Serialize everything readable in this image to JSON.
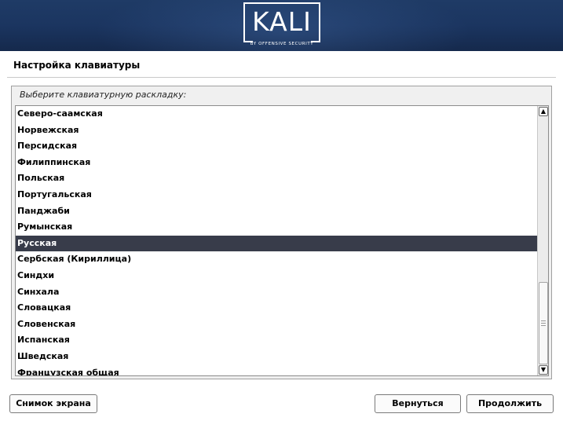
{
  "header": {
    "logo_text": "KALI",
    "logo_subtitle": "BY OFFENSIVE SECURITY"
  },
  "page": {
    "title": "Настройка клавиатуры"
  },
  "keyboard": {
    "prompt": "Выберите клавиатурную раскладку:",
    "selected_index": 8,
    "items": [
      "Северо-саамская",
      "Норвежская",
      "Персидская",
      "Филиппинская",
      "Польская",
      "Португальская",
      "Панджаби",
      "Румынская",
      "Русская",
      "Сербская (Кириллица)",
      "Синдхи",
      "Синхала",
      "Словацкая",
      "Словенская",
      "Испанская",
      "Шведская",
      "Французская общая"
    ]
  },
  "buttons": {
    "screenshot": "Снимок экрана",
    "back": "Вернуться",
    "continue": "Продолжить"
  },
  "colors": {
    "banner": "#1b3560",
    "selection": "#383c4a"
  },
  "icons": {
    "scroll_up": "chevron-up-icon",
    "scroll_down": "chevron-down-icon"
  }
}
